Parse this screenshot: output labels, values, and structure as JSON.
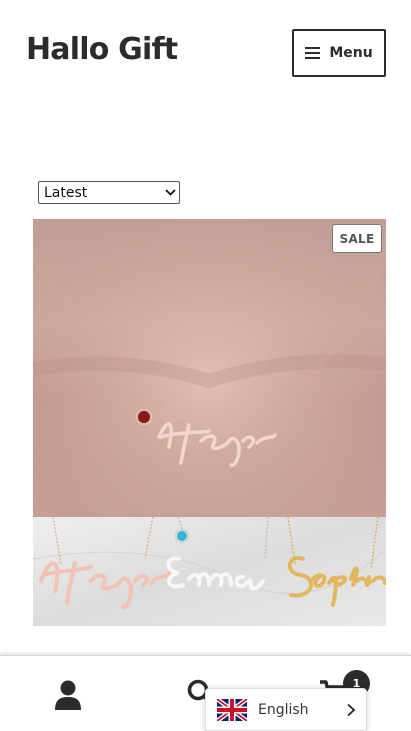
{
  "header": {
    "site_title": "Hallo Gift",
    "menu_label": "Menu"
  },
  "sort": {
    "selected": "Latest"
  },
  "product": {
    "badge": "SALE"
  },
  "cart": {
    "count": "1"
  },
  "language": {
    "selected": "English"
  },
  "icons": [
    "menu-icon",
    "chevron-down-icon",
    "user-icon",
    "search-icon",
    "cart-icon",
    "uk-flag-icon",
    "chevron-right-icon"
  ]
}
